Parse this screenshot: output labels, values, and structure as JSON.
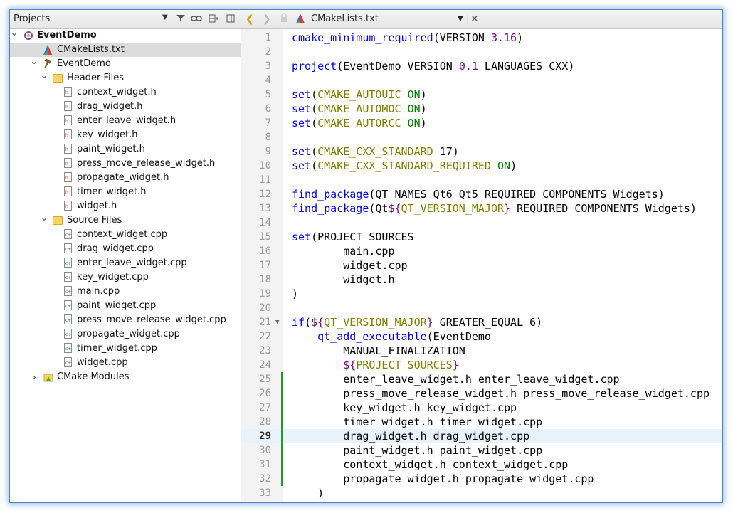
{
  "projects": {
    "title": "Projects",
    "tree": [
      {
        "label": "EventDemo",
        "depth": 0,
        "expanded": true,
        "icon": "project-icon",
        "bold": true
      },
      {
        "label": "CMakeLists.txt",
        "depth": 1,
        "icon": "cmake-file-icon",
        "selected": true
      },
      {
        "label": "EventDemo",
        "depth": 1,
        "expanded": true,
        "icon": "hammer-icon"
      },
      {
        "label": "Header Files",
        "depth": 2,
        "expanded": true,
        "icon": "folder-icon"
      },
      {
        "label": "context_widget.h",
        "depth": 3,
        "icon": "header-file-icon"
      },
      {
        "label": "drag_widget.h",
        "depth": 3,
        "icon": "header-file-icon"
      },
      {
        "label": "enter_leave_widget.h",
        "depth": 3,
        "icon": "header-file-icon"
      },
      {
        "label": "key_widget.h",
        "depth": 3,
        "icon": "header-file-icon"
      },
      {
        "label": "paint_widget.h",
        "depth": 3,
        "icon": "header-file-icon"
      },
      {
        "label": "press_move_release_widget.h",
        "depth": 3,
        "icon": "header-file-icon"
      },
      {
        "label": "propagate_widget.h",
        "depth": 3,
        "icon": "header-file-icon"
      },
      {
        "label": "timer_widget.h",
        "depth": 3,
        "icon": "header-file-icon"
      },
      {
        "label": "widget.h",
        "depth": 3,
        "icon": "header-file-icon"
      },
      {
        "label": "Source Files",
        "depth": 2,
        "expanded": true,
        "icon": "folder-icon"
      },
      {
        "label": "context_widget.cpp",
        "depth": 3,
        "icon": "cpp-file-icon"
      },
      {
        "label": "drag_widget.cpp",
        "depth": 3,
        "icon": "cpp-file-icon"
      },
      {
        "label": "enter_leave_widget.cpp",
        "depth": 3,
        "icon": "cpp-file-icon"
      },
      {
        "label": "key_widget.cpp",
        "depth": 3,
        "icon": "cpp-file-icon"
      },
      {
        "label": "main.cpp",
        "depth": 3,
        "icon": "cpp-file-icon"
      },
      {
        "label": "paint_widget.cpp",
        "depth": 3,
        "icon": "cpp-file-icon"
      },
      {
        "label": "press_move_release_widget.cpp",
        "depth": 3,
        "icon": "cpp-file-icon"
      },
      {
        "label": "propagate_widget.cpp",
        "depth": 3,
        "icon": "cpp-file-icon"
      },
      {
        "label": "timer_widget.cpp",
        "depth": 3,
        "icon": "cpp-file-icon"
      },
      {
        "label": "widget.cpp",
        "depth": 3,
        "icon": "cpp-file-icon"
      },
      {
        "label": "CMake Modules",
        "depth": 1,
        "expanded": false,
        "icon": "cmake-modules-icon"
      }
    ]
  },
  "editor": {
    "file_name": "CMakeLists.txt",
    "current_line": 29,
    "modified_lines": [
      25,
      26,
      27,
      28,
      29,
      30,
      31,
      32
    ],
    "lines": [
      {
        "n": "1",
        "text": "cmake_minimum_required(VERSION 3.16)"
      },
      {
        "n": "2",
        "text": ""
      },
      {
        "n": "3",
        "text": "project(EventDemo VERSION 0.1 LANGUAGES CXX)"
      },
      {
        "n": "4",
        "text": ""
      },
      {
        "n": "5",
        "text": "set(CMAKE_AUTOUIC ON)"
      },
      {
        "n": "6",
        "text": "set(CMAKE_AUTOMOC ON)"
      },
      {
        "n": "7",
        "text": "set(CMAKE_AUTORCC ON)"
      },
      {
        "n": "8",
        "text": ""
      },
      {
        "n": "9",
        "text": "set(CMAKE_CXX_STANDARD 17)"
      },
      {
        "n": "10",
        "text": "set(CMAKE_CXX_STANDARD_REQUIRED ON)"
      },
      {
        "n": "11",
        "text": ""
      },
      {
        "n": "12",
        "text": "find_package(QT NAMES Qt6 Qt5 REQUIRED COMPONENTS Widgets)"
      },
      {
        "n": "13",
        "text": "find_package(Qt${QT_VERSION_MAJOR} REQUIRED COMPONENTS Widgets)"
      },
      {
        "n": "14",
        "text": ""
      },
      {
        "n": "15",
        "text": "set(PROJECT_SOURCES"
      },
      {
        "n": "16",
        "text": "        main.cpp"
      },
      {
        "n": "17",
        "text": "        widget.cpp"
      },
      {
        "n": "18",
        "text": "        widget.h"
      },
      {
        "n": "19",
        "text": ")"
      },
      {
        "n": "20",
        "text": ""
      },
      {
        "n": "21",
        "text": "if(${QT_VERSION_MAJOR} GREATER_EQUAL 6)",
        "fold": true
      },
      {
        "n": "22",
        "text": "    qt_add_executable(EventDemo"
      },
      {
        "n": "23",
        "text": "        MANUAL_FINALIZATION"
      },
      {
        "n": "24",
        "text": "        ${PROJECT_SOURCES}"
      },
      {
        "n": "25",
        "text": "        enter_leave_widget.h enter_leave_widget.cpp"
      },
      {
        "n": "26",
        "text": "        press_move_release_widget.h press_move_release_widget.cpp"
      },
      {
        "n": "27",
        "text": "        key_widget.h key_widget.cpp"
      },
      {
        "n": "28",
        "text": "        timer_widget.h timer_widget.cpp"
      },
      {
        "n": "29",
        "text": "        drag_widget.h drag_widget.cpp"
      },
      {
        "n": "30",
        "text": "        paint_widget.h paint_widget.cpp"
      },
      {
        "n": "31",
        "text": "        context_widget.h context_widget.cpp"
      },
      {
        "n": "32",
        "text": "        propagate_widget.h propagate_widget.cpp"
      },
      {
        "n": "33",
        "text": "    )"
      }
    ]
  },
  "colors": {
    "keyword": "#0000ff",
    "variable": "#808000",
    "number": "#000080",
    "on": "#008000",
    "macro": "#800080",
    "modified_marker": "#1f9d2a",
    "current_line_bg": "#e8f2fb",
    "selection_bg": "#dcdcdc"
  }
}
